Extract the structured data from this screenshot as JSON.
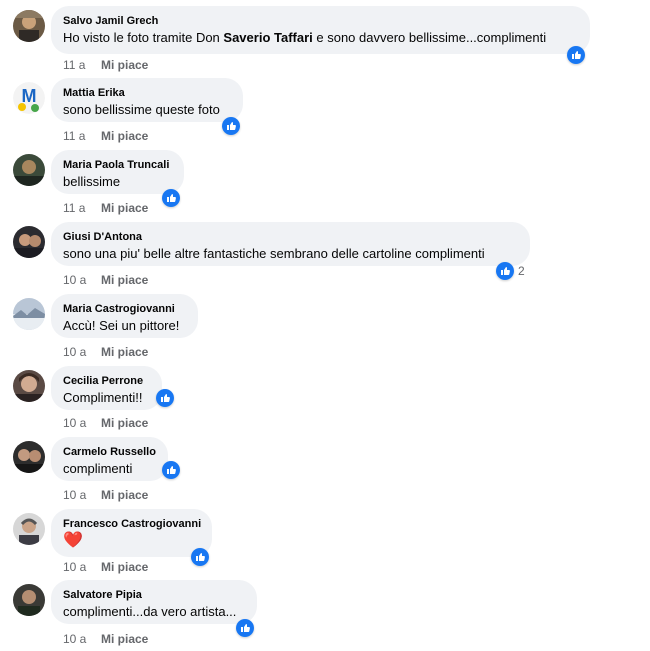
{
  "colors": {
    "bubble": "#f0f2f5",
    "meta_text": "#65676b",
    "like_blue": "#1877f2",
    "heart_red": "#e41e3f"
  },
  "like_action_label": "Mi piace",
  "comments": [
    {
      "author": "Salvo Jamil Grech",
      "text_before": "Ho visto le foto tramite Don ",
      "text_bold": "Saverio Taffari",
      "text_after": " e sono davvero bellissime...complimenti",
      "time": "11 a",
      "reaction_icon": "thumbs-up-icon"
    },
    {
      "author": "Mattia Erika",
      "text": "sono bellissime queste foto",
      "time": "11 a",
      "reaction_icon": "thumbs-up-icon"
    },
    {
      "author": "Maria Paola Truncali",
      "text": "bellissime",
      "time": "11 a",
      "reaction_icon": "thumbs-up-icon"
    },
    {
      "author": "Giusi D'Antona",
      "text": "sono una piu' belle altre fantastiche sembrano delle cartoline complimenti",
      "time": "10 a",
      "reaction_icon": "thumbs-up-icon",
      "reaction_count": "2"
    },
    {
      "author": "Maria Castrogiovanni",
      "text": "Accù! Sei un pittore!",
      "time": "10 a"
    },
    {
      "author": "Cecilia Perrone",
      "text": "Complimenti!!",
      "time": "10 a",
      "reaction_icon": "thumbs-up-icon"
    },
    {
      "author": "Carmelo Russello",
      "text": "complimenti",
      "time": "10 a",
      "reaction_icon": "thumbs-up-icon"
    },
    {
      "author": "Francesco Castrogiovanni",
      "text": "❤️",
      "time": "10 a",
      "reaction_icon": "thumbs-up-icon"
    },
    {
      "author": "Salvatore Pipia",
      "text": "complimenti...da vero artista...",
      "time": "10 a",
      "reaction_icon": "thumbs-up-icon"
    }
  ]
}
